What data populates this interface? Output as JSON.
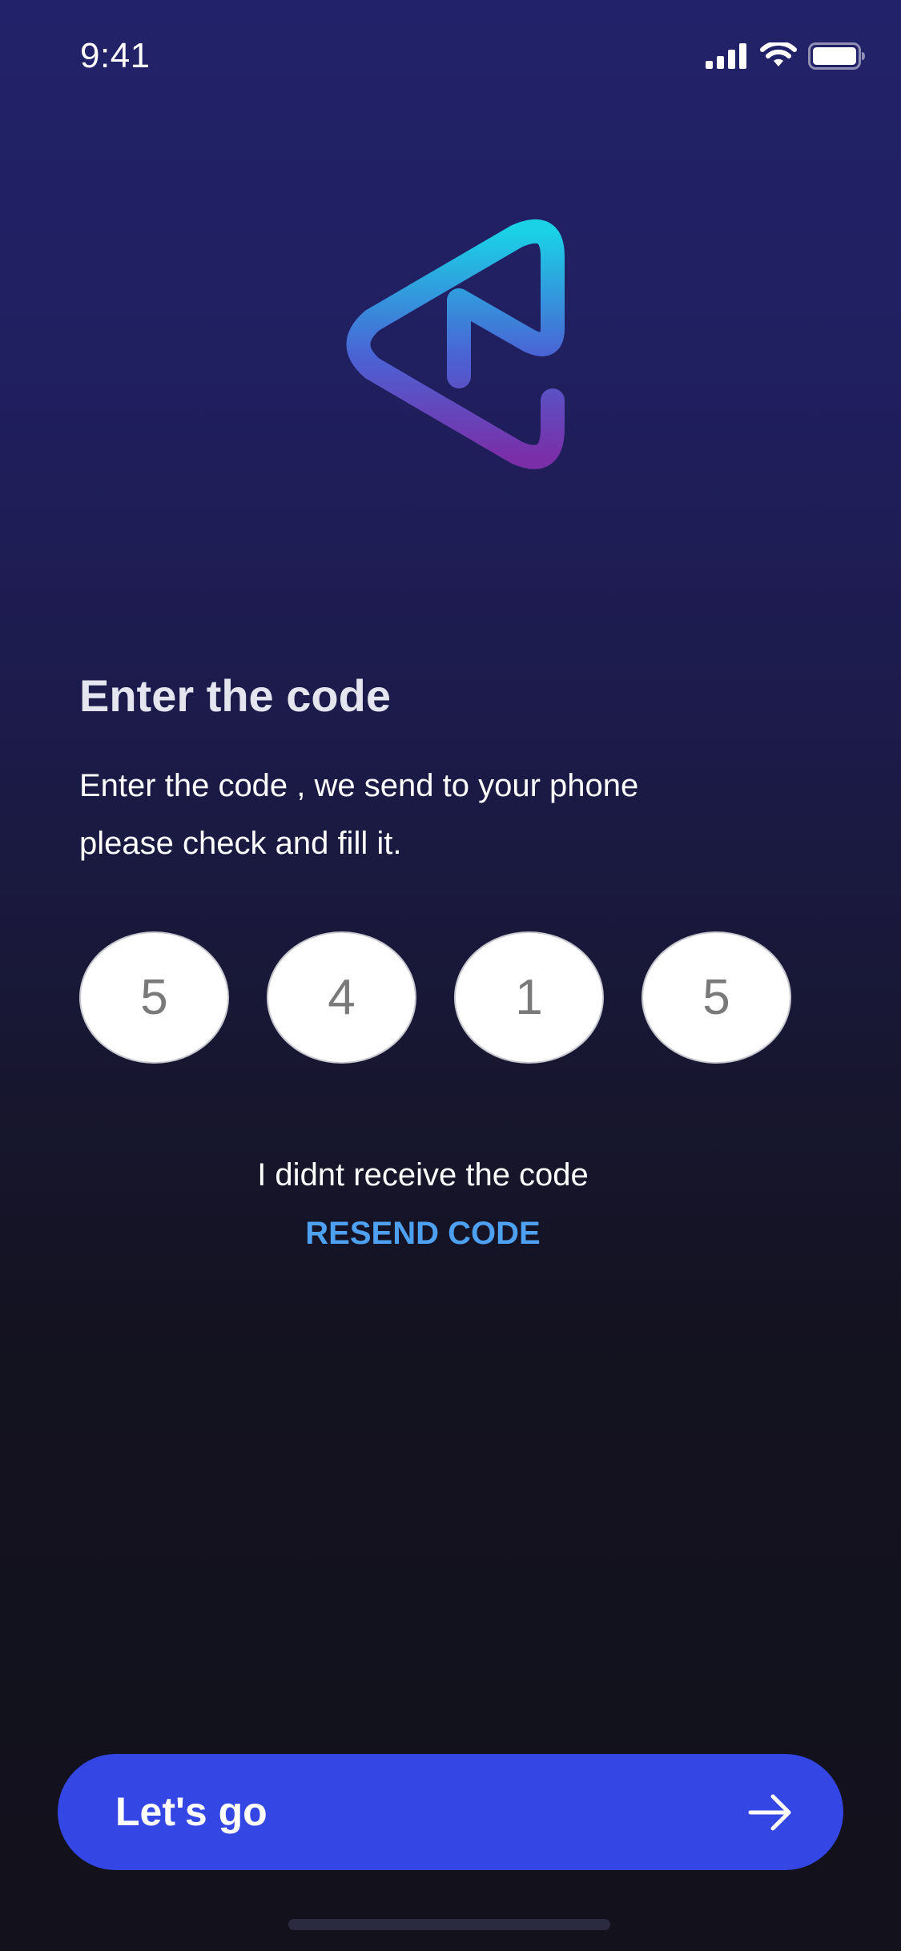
{
  "status_bar": {
    "time": "9:41",
    "icons": [
      "cellular-signal-icon",
      "wifi-icon",
      "battery-icon"
    ]
  },
  "logo": {
    "icon": "play-logo-icon",
    "gradient_colors": [
      "#1ad1e6",
      "#4a5fd8",
      "#7a2fa8"
    ]
  },
  "screen": {
    "heading": "Enter the code",
    "subtitle_line1": "Enter the code , we send to your phone",
    "subtitle_line2": "please check and fill it."
  },
  "code": {
    "digits": [
      "5",
      "4",
      "1",
      "5"
    ]
  },
  "resend": {
    "prompt": "I didnt receive the code",
    "link_label": "RESEND CODE"
  },
  "cta": {
    "label": "Let's go",
    "icon": "arrow-right-icon"
  },
  "colors": {
    "accent": "#3446e4",
    "link": "#4ea0f0",
    "background_top": "#22226a",
    "background_bottom": "#13121f"
  }
}
